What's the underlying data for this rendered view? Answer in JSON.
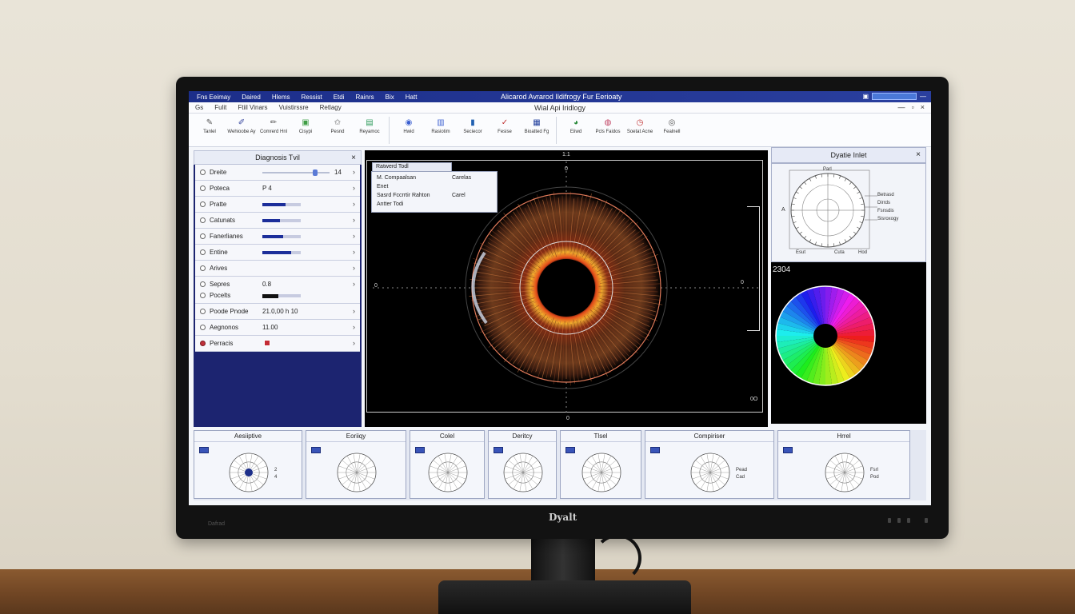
{
  "titlebar": {
    "menu": [
      "Fns Eeimay",
      "Daired",
      "Hlems",
      "Ressist",
      "Etdi",
      "Rainrs",
      "Bix",
      "Hatt"
    ],
    "title": "Alicarod Avrarod Ildifrogy Fur Eerioaty",
    "buttons": [
      "▣",
      "—"
    ]
  },
  "menubar": {
    "items": [
      "Gs",
      "Fulit",
      "Ftiil Vinars",
      "Vuistirssre",
      "Retlagy"
    ],
    "subtitle": "Wial Api Iridlogy",
    "window_controls": [
      "—",
      "▫",
      "×"
    ]
  },
  "toolbar": {
    "tools": [
      {
        "label": "Tanlel",
        "icon": "pen-icon",
        "color": "#5a5a5a"
      },
      {
        "label": "Wehioobe Ay",
        "icon": "brush-icon",
        "color": "#3a4aa0"
      },
      {
        "label": "Comrerd Hnl",
        "icon": "pencil-icon",
        "color": "#5a5a5a"
      },
      {
        "label": "Cisypi",
        "icon": "image-icon",
        "color": "#3f9d45"
      },
      {
        "label": "Pesnd",
        "icon": "star-icon",
        "color": "#5a5a5a"
      },
      {
        "label": "Reyamoc",
        "icon": "chart-icon",
        "color": "#2e9a5a"
      },
      {
        "label": "Hwid",
        "icon": "globe-icon",
        "color": "#3b5fd0"
      },
      {
        "label": "Rasiotim",
        "icon": "document-icon",
        "color": "#3b5fd0"
      },
      {
        "label": "Seciecor",
        "icon": "tablet-icon",
        "color": "#2060b0"
      },
      {
        "label": "Fesise",
        "icon": "check-icon",
        "color": "#c03030"
      },
      {
        "label": "Bioatted Fg",
        "icon": "book-icon",
        "color": "#1c3a9a"
      },
      {
        "label": "Eiiwd",
        "icon": "color-wheel-icon",
        "color": "#2a8a3a"
      },
      {
        "label": "Pcls Faidos",
        "icon": "palette-icon",
        "color": "#c04060"
      },
      {
        "label": "Soetat Acne",
        "icon": "clock-icon",
        "color": "#c03030"
      },
      {
        "label": "Fealnell",
        "icon": "target-icon",
        "color": "#555555"
      }
    ]
  },
  "diagnosis_panel": {
    "title": "Diagnosis Tvil",
    "rows": [
      {
        "label": "Dreite",
        "type": "slider",
        "value": "14",
        "level": 0.78
      },
      {
        "label": "Poteca",
        "type": "text",
        "value": "P 4"
      },
      {
        "label": "Pratte",
        "type": "bar",
        "level": 0.6
      },
      {
        "label": "Catunats",
        "type": "bar",
        "level": 0.45
      },
      {
        "label": "Fanerlianes",
        "type": "bar",
        "level": 0.55
      },
      {
        "label": "Entine",
        "type": "bar",
        "level": 0.75
      },
      {
        "label": "Arives",
        "type": "none"
      },
      {
        "label": "Sepres",
        "label2": "Pocelts",
        "type": "tall",
        "value": "0.8"
      },
      {
        "label": "Poode Pnode",
        "type": "text",
        "value": "21.0,00 h 10"
      },
      {
        "label": "Aegnonos",
        "type": "text",
        "value": "11.00"
      },
      {
        "label": "Perracis",
        "type": "red"
      }
    ]
  },
  "viewer": {
    "ticks": {
      "top": "0",
      "top2": "0",
      "left": "0",
      "right": "0",
      "bottom": "0",
      "corner": "0O",
      "corner_top": "1:1"
    },
    "popup": {
      "title": "Ratwerd Todl",
      "items": [
        {
          "label": "M. Compaalsan",
          "value": "Carelas"
        },
        {
          "label": "Enet",
          "value": ""
        },
        {
          "label": "Sasrd Fccrrtir Rahton",
          "value": "Carel"
        },
        {
          "label": "Antter Todi",
          "value": ""
        }
      ]
    }
  },
  "right_panel": {
    "title": "Dyatie Inlet",
    "figure_labels": [
      "Parl",
      "Betrasd",
      "Dirrds",
      "Fsnsdis",
      "Sisroxogy",
      "A",
      "Esut",
      "Cuta",
      "Hod"
    ],
    "section_label": "2304"
  },
  "thumbnails": [
    {
      "title": "Aesiiptive",
      "notes": [
        "2",
        "4"
      ]
    },
    {
      "title": "Eoriiqy",
      "notes": []
    },
    {
      "title": "Colel",
      "notes": []
    },
    {
      "title": "Deritcy",
      "notes": []
    },
    {
      "title": "Tlsel",
      "notes": []
    },
    {
      "title": "Compiriser",
      "notes": [
        "Pead",
        "Cad"
      ]
    },
    {
      "title": "Hrrel",
      "notes": [
        "Fsrl",
        "Pod"
      ]
    }
  ],
  "monitor": {
    "brand": "Dyalt",
    "model": "Dafrad"
  },
  "colors": {
    "accent": "#1c2e8a",
    "panel_dark": "#1c2470",
    "iris_red": "#c0392b",
    "iris_amber": "#e8a33a"
  }
}
